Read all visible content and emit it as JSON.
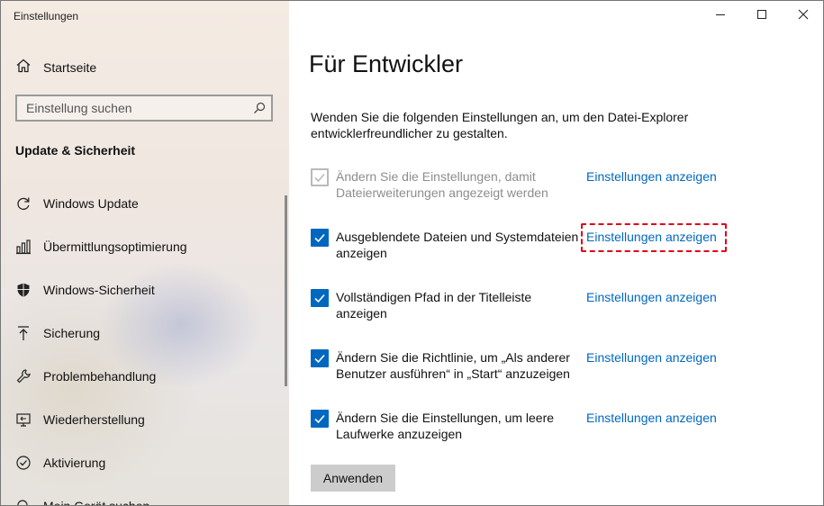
{
  "window": {
    "title": "Einstellungen",
    "controls": {
      "minimize": "minimize-icon",
      "maximize": "maximize-icon",
      "close": "close-icon"
    }
  },
  "sidebar": {
    "home": {
      "label": "Startseite",
      "icon": "home-icon"
    },
    "search": {
      "placeholder": "Einstellung suchen",
      "value": "",
      "icon": "search-icon"
    },
    "section_title": "Update & Sicherheit",
    "items": [
      {
        "label": "Windows Update",
        "icon": "refresh-icon"
      },
      {
        "label": "Übermittlungsoptimierung",
        "icon": "delivery-icon"
      },
      {
        "label": "Windows-Sicherheit",
        "icon": "shield-icon"
      },
      {
        "label": "Sicherung",
        "icon": "upload-icon"
      },
      {
        "label": "Problembehandlung",
        "icon": "wrench-icon"
      },
      {
        "label": "Wiederherstellung",
        "icon": "recovery-icon"
      },
      {
        "label": "Aktivierung",
        "icon": "check-circle-icon"
      },
      {
        "label": "Mein Gerät suchen",
        "icon": "find-device-icon"
      }
    ]
  },
  "main": {
    "title": "Für Entwickler",
    "description": "Wenden Sie die folgenden Einstellungen an, um den Datei-Explorer entwicklerfreundlicher zu gestalten.",
    "settings": [
      {
        "text": "Ändern Sie die Einstellungen, damit Dateierweiterungen angezeigt werden",
        "checked": true,
        "disabled": true,
        "link": "Einstellungen anzeigen"
      },
      {
        "text": "Ausgeblendete Dateien und Systemdateien anzeigen",
        "checked": true,
        "disabled": false,
        "link": "Einstellungen anzeigen",
        "highlighted": true
      },
      {
        "text": "Vollständigen Pfad in der Titelleiste anzeigen",
        "checked": true,
        "disabled": false,
        "link": "Einstellungen anzeigen"
      },
      {
        "text": "Ändern Sie die Richtlinie, um „Als anderer Benutzer ausführen“ in „Start“ anzuzeigen",
        "checked": true,
        "disabled": false,
        "link": "Einstellungen anzeigen"
      },
      {
        "text": "Ändern Sie die Einstellungen, um leere Laufwerke anzuzeigen",
        "checked": true,
        "disabled": false,
        "link": "Einstellungen anzeigen"
      }
    ],
    "apply_label": "Anwenden"
  },
  "colors": {
    "accent": "#0067c0",
    "highlight": "#e0001b",
    "disabled": "#b9b9b9"
  }
}
